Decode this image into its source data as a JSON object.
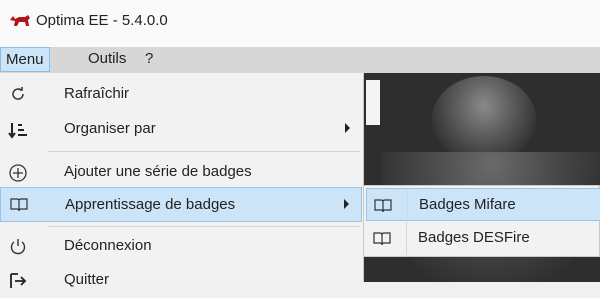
{
  "window": {
    "title": "Optima EE - 5.4.0.0",
    "logo_icon": "bull-logo-icon"
  },
  "menubar": {
    "items": [
      "Menu",
      "Outils",
      "?"
    ]
  },
  "menu": {
    "items": [
      {
        "label": "Rafraîchir",
        "icon": "refresh-icon"
      },
      {
        "label": "Organiser par",
        "icon": "sort-icon",
        "submenu": true
      },
      {
        "label": "Ajouter une série de badges",
        "icon": "add-circle-icon"
      },
      {
        "label": "Apprentissage de badges",
        "icon": "book-icon",
        "submenu": true,
        "highlighted": true
      },
      {
        "label": "Déconnexion",
        "icon": "power-icon"
      },
      {
        "label": "Quitter",
        "icon": "exit-icon"
      }
    ]
  },
  "submenu": {
    "items": [
      {
        "label": "Badges Mifare",
        "icon": "book-icon",
        "highlighted": true
      },
      {
        "label": "Badges DESFire",
        "icon": "book-icon"
      }
    ]
  },
  "colors": {
    "highlight": "#cce4f7",
    "highlight_border": "#9ac5e8",
    "menubar": "#d7d7d7",
    "workspace": "#2e2e2e",
    "logo": "#b3121a"
  }
}
